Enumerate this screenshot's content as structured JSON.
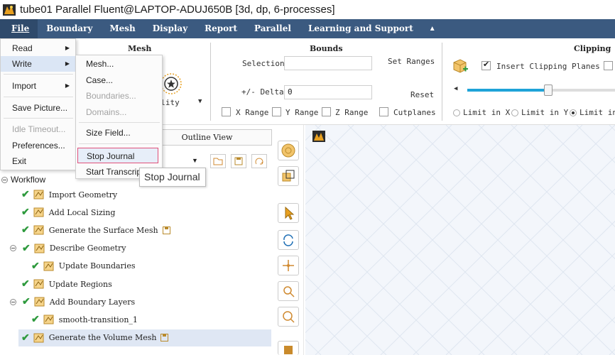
{
  "window": {
    "title": "tube01 Parallel Fluent@LAPTOP-ADUJ650B  [3d, dp, 6-processes]"
  },
  "menubar": {
    "items": [
      {
        "label": "File",
        "underline": "F"
      },
      {
        "label": "Boundary"
      },
      {
        "label": "Mesh"
      },
      {
        "label": "Display"
      },
      {
        "label": "Report"
      },
      {
        "label": "Parallel"
      },
      {
        "label": "Learning and Support"
      }
    ],
    "collapse_icon": "▲"
  },
  "ribbon": {
    "mesh_group_title": "Mesh",
    "quality_label": "uality",
    "bounds": {
      "title": "Bounds",
      "selection_label": "Selection",
      "selection_value": "",
      "set_ranges_label": "Set Ranges",
      "delta_label": "+/- Delta",
      "delta_value": "0",
      "reset_label": "Reset",
      "x_range": "X Range",
      "y_range": "Y Range",
      "z_range": "Z Range",
      "cutplanes": "Cutplanes"
    },
    "clipping": {
      "title": "Clipping",
      "insert_label": "Insert Clipping Planes",
      "insert_checked": true,
      "slider_value_percent": 55,
      "limit_x": "Limit in X",
      "limit_y": "Limit in Y",
      "limit_z": "Limit in"
    }
  },
  "file_menu": {
    "items": [
      {
        "label": "Read",
        "submenu": true,
        "disabled": false
      },
      {
        "label": "Write",
        "submenu": true,
        "disabled": false,
        "active": true
      },
      {
        "label": "Import",
        "submenu": true,
        "disabled": false
      },
      {
        "label": "Save Picture...",
        "submenu": false,
        "disabled": false
      },
      {
        "label": "Idle Timeout...",
        "submenu": false,
        "disabled": true
      },
      {
        "label": "Preferences...",
        "submenu": false,
        "disabled": false
      },
      {
        "label": "Exit",
        "submenu": false,
        "disabled": false
      }
    ]
  },
  "write_submenu": {
    "items": [
      {
        "label": "Mesh...",
        "disabled": false
      },
      {
        "label": "Case...",
        "disabled": false
      },
      {
        "label": "Boundaries...",
        "disabled": true
      },
      {
        "label": "Domains...",
        "disabled": true
      },
      {
        "label": "Size Field...",
        "disabled": false
      },
      {
        "label": "Stop Journal",
        "disabled": false,
        "highlight": true
      },
      {
        "label": "Start Transcript...",
        "disabled": false
      }
    ]
  },
  "tooltip": {
    "text": "Stop Journal"
  },
  "outline": {
    "tab_label": "Outline View",
    "workflow_label": "Workflow",
    "rows": [
      {
        "label": "Import Geometry",
        "indent": 1,
        "checked": true,
        "icon": "import-geometry-icon"
      },
      {
        "label": "Add Local Sizing",
        "indent": 1,
        "checked": true,
        "icon": "local-sizing-icon"
      },
      {
        "label": "Generate the Surface Mesh",
        "indent": 1,
        "checked": true,
        "icon": "surface-mesh-icon",
        "save": true
      },
      {
        "label": "Describe Geometry",
        "indent": 0,
        "checked": true,
        "icon": "describe-geometry-icon",
        "expander": true
      },
      {
        "label": "Update Boundaries",
        "indent": 2,
        "checked": true,
        "icon": "update-boundaries-icon"
      },
      {
        "label": "Update Regions",
        "indent": 1,
        "checked": true,
        "icon": "update-regions-icon"
      },
      {
        "label": "Add Boundary Layers",
        "indent": 0,
        "checked": true,
        "icon": "boundary-layers-icon",
        "expander": true
      },
      {
        "label": "smooth-transition_1",
        "indent": 2,
        "checked": true,
        "icon": "boundary-layers-icon"
      },
      {
        "label": "Generate the Volume Mesh",
        "indent": 1,
        "checked": true,
        "icon": "volume-mesh-icon",
        "save": true,
        "selected": true
      }
    ]
  },
  "colors": {
    "menubar": "#3b5a80",
    "check": "#2e9a3d",
    "highlight_border": "#e0507a",
    "slider": "#1fa3d8"
  }
}
